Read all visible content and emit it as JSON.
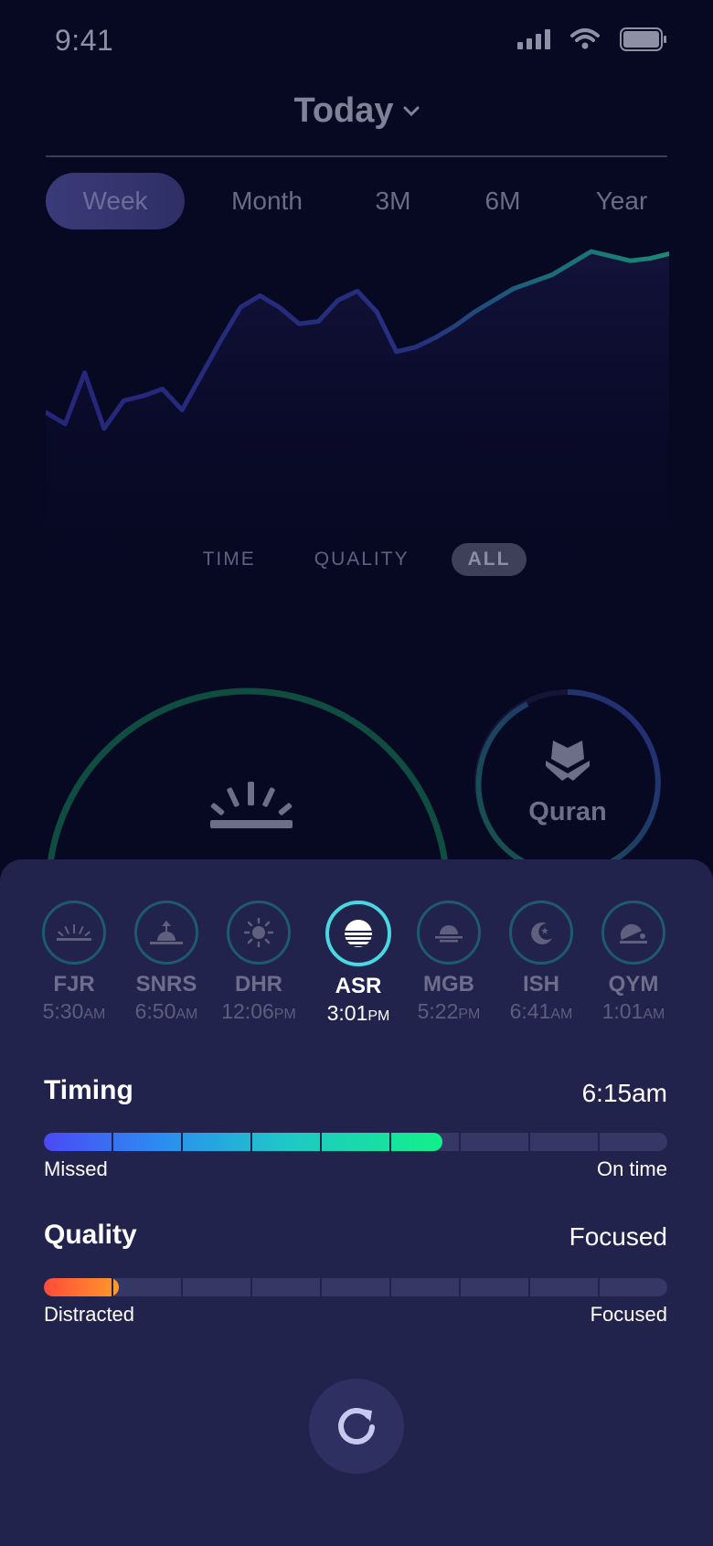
{
  "status": {
    "time": "9:41"
  },
  "header": {
    "title": "Today"
  },
  "range_tabs": [
    {
      "label": "Week",
      "active": true
    },
    {
      "label": "Month"
    },
    {
      "label": "3M"
    },
    {
      "label": "6M"
    },
    {
      "label": "Year"
    }
  ],
  "chart_filters": [
    "TIME",
    "QUALITY",
    "ALL"
  ],
  "chart_active_filter": "ALL",
  "chart_data": {
    "type": "area",
    "x": [
      0,
      1,
      2,
      3,
      4,
      5,
      6,
      7,
      8,
      9,
      10,
      11,
      12,
      13,
      14,
      15,
      16,
      17,
      18,
      19,
      20,
      21,
      22,
      23,
      24,
      25,
      26,
      27,
      28,
      29,
      30,
      31,
      32
    ],
    "values": [
      0.31,
      0.26,
      0.48,
      0.24,
      0.36,
      0.38,
      0.41,
      0.32,
      0.47,
      0.62,
      0.76,
      0.81,
      0.76,
      0.69,
      0.7,
      0.79,
      0.83,
      0.74,
      0.57,
      0.59,
      0.63,
      0.68,
      0.74,
      0.79,
      0.84,
      0.87,
      0.9,
      0.95,
      1.0,
      0.98,
      0.96,
      0.97,
      0.99
    ],
    "ylim": [
      0,
      1
    ],
    "series_colors": [
      "#26267a",
      "#1a8a74"
    ],
    "grid": false
  },
  "summary": {
    "main_prayer_time": "",
    "secondary_label": "Quran"
  },
  "prayers": [
    {
      "name": "FJR",
      "time": "5:30",
      "ampm": "AM",
      "icon": "sunrise-lines-icon"
    },
    {
      "name": "SNRS",
      "time": "6:50",
      "ampm": "AM",
      "icon": "sunrise-arrow-icon"
    },
    {
      "name": "DHR",
      "time": "12:06",
      "ampm": "PM",
      "icon": "sun-icon"
    },
    {
      "name": "ASR",
      "time": "3:01",
      "ampm": "PM",
      "icon": "half-sun-icon",
      "active": true
    },
    {
      "name": "MGB",
      "time": "5:22",
      "ampm": "PM",
      "icon": "sunset-icon"
    },
    {
      "name": "ISH",
      "time": "6:41",
      "ampm": "AM",
      "icon": "moon-star-icon"
    },
    {
      "name": "QYM",
      "time": "1:01",
      "ampm": "AM",
      "icon": "prostration-icon"
    }
  ],
  "timing": {
    "label": "Timing",
    "value": "6:15am",
    "min": "Missed",
    "max": "On time",
    "level": 0.64
  },
  "quality": {
    "label": "Quality",
    "value": "Focused",
    "min": "Distracted",
    "max": "Focused",
    "level": 0.12
  }
}
